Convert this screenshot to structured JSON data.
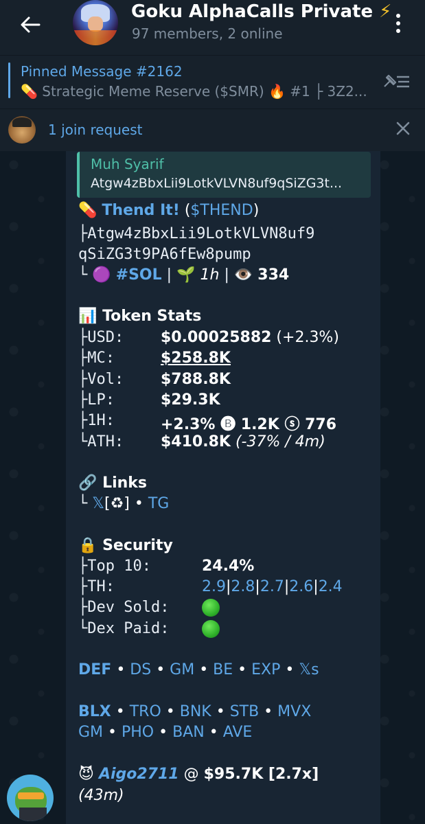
{
  "header": {
    "title": "Goku AlphaCalls Private",
    "title_emoji": "⚡",
    "subtitle": "97 members, 2 online"
  },
  "pinned": {
    "title": "Pinned Message #2162",
    "text": "💊 Strategic Meme Reserve ($SMR) 🔥 #1 ├ 3Z2..."
  },
  "join_request": {
    "text": "1 join request"
  },
  "message": {
    "reply": {
      "name": "Muh Syarif",
      "text": "Atgw4zBbxLii9LotkVLVN8uf9qSiZG3t..."
    },
    "token_line": {
      "emoji": "💊",
      "name": "Thend It!",
      "ticker": "($THEND)"
    },
    "address_line1": "├Atgw4zBbxLii9LotkVLVN8uf9",
    "address_line2": "qSiZG3t9PA6fEw8pump",
    "meta": {
      "tree": "└",
      "chain_emoji": "🟣",
      "chain": "#SOL",
      "sep": "|",
      "age_emoji": "🌱",
      "age": "1h",
      "views_emoji": "👁️",
      "views": "334"
    },
    "stats": {
      "heading_emoji": "📊",
      "heading": "Token Stats",
      "rows": [
        {
          "key": "├USD: ",
          "value": "$0.00025882",
          "extra": " (+2.3%)"
        },
        {
          "key": "├MC:  ",
          "value": "$258.8K",
          "extra": ""
        },
        {
          "key": "├Vol: ",
          "value": "$788.8K",
          "extra": ""
        },
        {
          "key": "├LP:  ",
          "value": "$29.3K",
          "extra": ""
        },
        {
          "key": "├1H:  ",
          "value": "+2.3% 🅑 1.2K ⓢ 776",
          "extra": ""
        },
        {
          "key": "└ATH: ",
          "value": "$410.8K",
          "extra": " (-37% / 4m)"
        }
      ]
    },
    "links": {
      "heading_emoji": "🔗",
      "heading": "Links",
      "tree": "└",
      "x": "𝕏",
      "x_extra": "[♻]",
      "dot": " • ",
      "tg": "TG"
    },
    "security": {
      "heading_emoji": "🔒",
      "heading": "Security",
      "top10_key": "├Top 10: ",
      "top10_val": "24.4%",
      "th_key": "├TH:",
      "th_vals": [
        "2.9",
        "2.8",
        "2.7",
        "2.6",
        "2.4"
      ],
      "dev_key": "├Dev Sold: ",
      "dex_key": "└Dex Paid: "
    },
    "def_row": {
      "label": "DEF",
      "items": [
        "DS",
        "GM",
        "BE",
        "EXP",
        "𝕏s"
      ]
    },
    "blx_row": {
      "label": "BLX",
      "items1": [
        "TRO",
        "BNK",
        "STB",
        "MVX"
      ],
      "items2": [
        "GM",
        "PHO",
        "BAN",
        "AVE"
      ]
    },
    "caller": {
      "emoji": "😈",
      "name": "Aigo2711",
      "at": " @ ",
      "price": "$95.7K [2.7x]",
      "time": "(43m)"
    }
  },
  "colors": {
    "link": "#5fa8e8",
    "reply_accent": "#4fbfa8",
    "bubble": "#182533",
    "header": "#17212b"
  }
}
